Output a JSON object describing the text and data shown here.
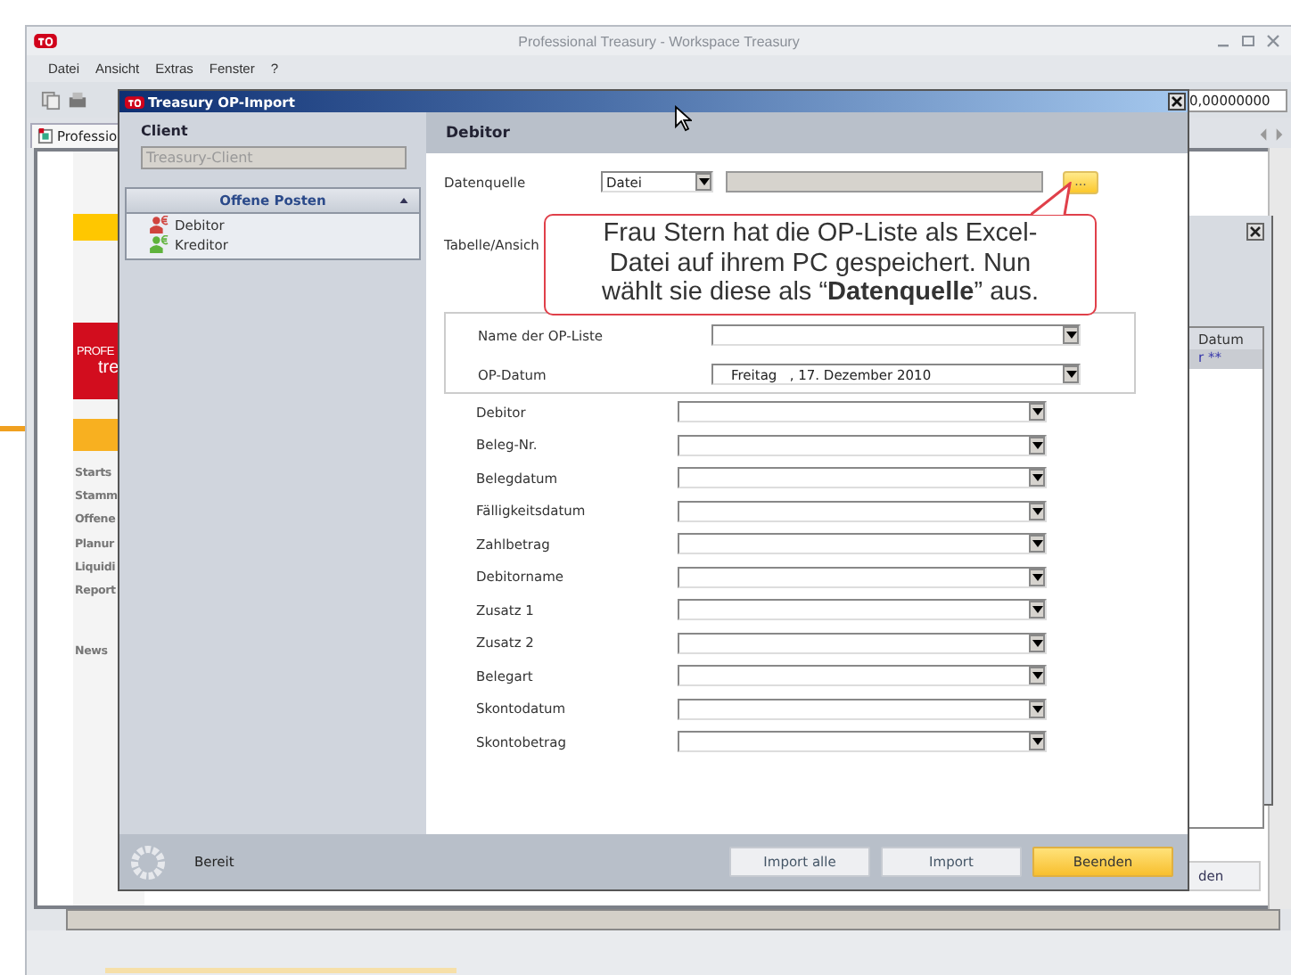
{
  "app_window": {
    "title": "Professional Treasury - Workspace Treasury",
    "menu": [
      "Datei",
      "Ansicht",
      "Extras",
      "Fenster",
      "?"
    ],
    "toolbar_value": "0,00000000",
    "tab": "Professio",
    "logo_text": [
      "PROFE",
      "tre"
    ],
    "nav_items": [
      "Starts",
      "Stamm",
      "Offene",
      "Planur",
      "Liquidi",
      "Report"
    ],
    "news": "News",
    "inner_window": {
      "column_header": "Datum",
      "cell": "r **",
      "button": "den"
    }
  },
  "dialog": {
    "title": "Treasury OP-Import",
    "client": {
      "label": "Client",
      "value": "Treasury-Client"
    },
    "panel": {
      "title": "Offene Posten",
      "expanded": true,
      "items": [
        {
          "label": "Debitor",
          "color": "#d0443e",
          "selected": false
        },
        {
          "label": "Kreditor",
          "color": "#5fb33c",
          "selected": false
        }
      ]
    },
    "section_title": "Debitor",
    "source": {
      "label": "Datenquelle",
      "value": "Datei",
      "browse": "..."
    },
    "table_label": "Tabelle/Ansich",
    "group_fields": [
      {
        "label": "Name der OP-Liste"
      },
      {
        "label": "OP-Datum",
        "value": "Freitag   , 17. Dezember 2010"
      }
    ],
    "fields": [
      "Debitor",
      "Beleg-Nr.",
      "Belegdatum",
      "Fälligkeitsdatum",
      "Zahlbetrag",
      "Debitorname",
      "Zusatz 1",
      "Zusatz 2",
      "Belegart",
      "Skontodatum",
      "Skontobetrag"
    ],
    "status": "Bereit",
    "buttons": [
      {
        "label": "Import alle",
        "kind": "normal"
      },
      {
        "label": "Import",
        "kind": "normal"
      },
      {
        "label": "Beenden",
        "kind": "primary"
      }
    ]
  },
  "callout": "Frau Stern hat die OP-Liste als Excel-Datei auf ihrem PC gespeichert. Nun wählt sie diese als “**Datenquelle**” aus."
}
